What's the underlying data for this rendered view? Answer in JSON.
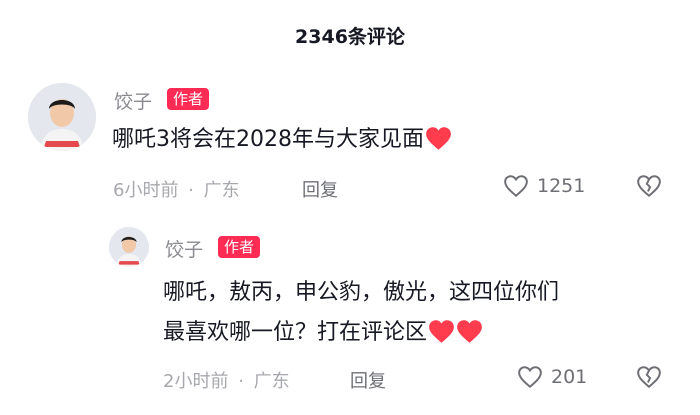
{
  "header": {
    "title": "2346条评论"
  },
  "comments": [
    {
      "author": "饺子",
      "badge": "作者",
      "text": "哪吒3将会在2028年与大家见面",
      "time": "6小时前",
      "location": "广东",
      "reply_label": "回复",
      "likes": "1251"
    },
    {
      "author": "饺子",
      "badge": "作者",
      "text_line1": "哪吒，敖丙，申公豹，傲光，这四位你们",
      "text_line2": "最喜欢哪一位？打在评论区",
      "time": "2小时前",
      "location": "广东",
      "reply_label": "回复",
      "likes": "201"
    }
  ],
  "separator": "·",
  "colors": {
    "badge": "#fe2c55",
    "heart": "#ff3b4e",
    "meta": "#a7a8ad"
  },
  "icons": {
    "like": "heart-outline-icon",
    "dislike": "broken-heart-icon",
    "emoji": "red-heart-emoji"
  }
}
